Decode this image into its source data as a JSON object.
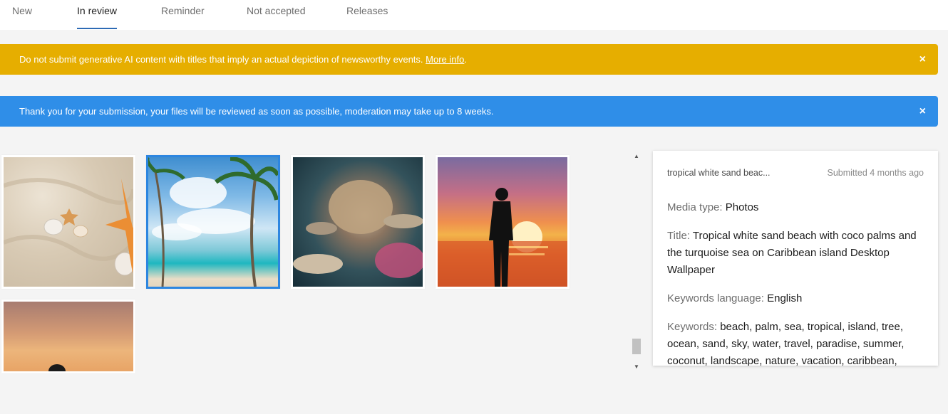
{
  "tabs": [
    {
      "label": "New"
    },
    {
      "label": "In review"
    },
    {
      "label": "Reminder"
    },
    {
      "label": "Not accepted"
    },
    {
      "label": "Releases"
    }
  ],
  "active_tab": "In review",
  "banners": {
    "warning": {
      "text": "Do not submit generative AI content with titles that imply an actual depiction of newsworthy events.",
      "link": "More info",
      "link_suffix": ".",
      "close": "×",
      "color": "#e6ae00"
    },
    "info": {
      "text": "Thank you for your submission, your files will be reviewed as soon as possible, moderation may take up to 8 weeks.",
      "close": "×",
      "color": "#2f8ee8"
    }
  },
  "thumbnails": [
    {
      "subject": "sand with seashells and starfish"
    },
    {
      "subject": "tropical beach with palm trees",
      "selected": true
    },
    {
      "subject": "coral reef"
    },
    {
      "subject": "silhouette of man at sunset"
    },
    {
      "subject": "silhouette at sunset"
    }
  ],
  "details": {
    "file_name": "tropical white sand beac...",
    "submitted": "Submitted 4 months ago",
    "media_type_label": "Media type:",
    "media_type": "Photos",
    "title_label": "Title:",
    "title": "Tropical white sand beach with coco palms and the turquoise sea on Caribbean island Desktop Wallpaper",
    "keywords_language_label": "Keywords language:",
    "keywords_language": "English",
    "keywords_label": "Keywords:",
    "keywords": "beach, palm, sea, tropical, island, tree, ocean, sand, sky, water, travel, paradise, summer, coconut, landscape, nature, vacation, caribbean, coast, sun,"
  },
  "colors": {
    "accent": "#2d86e0",
    "page_background": "#f4f4f4"
  }
}
